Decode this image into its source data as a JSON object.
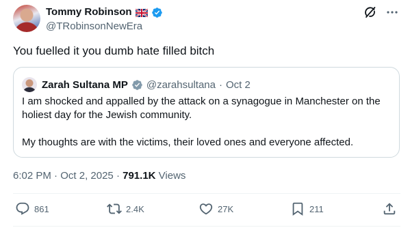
{
  "author": {
    "display_name": "Tommy Robinson",
    "handle": "@TRobinsonNewEra",
    "flag_icon": "uk-flag-icon",
    "verified_color": "#1d9bf0"
  },
  "tweet": {
    "text": "You fuelled it you dumb hate filled bitch"
  },
  "quote": {
    "display_name": "Zarah Sultana MP",
    "handle": "@zarahsultana",
    "separator": "·",
    "date": "Oct 2",
    "paragraphs": [
      "I am shocked and appalled by the attack on a synagogue in Manchester on the holiest day for the Jewish community.",
      "My thoughts are with the victims, their loved ones and everyone affected."
    ],
    "verified_color": "#829aab"
  },
  "meta": {
    "time": "6:02 PM",
    "separator": "·",
    "date": "Oct 2, 2025",
    "separator2": "·",
    "views_count": "791.1K",
    "views_label": "Views"
  },
  "actions": {
    "replies": "861",
    "reposts": "2.4K",
    "likes": "27K",
    "bookmarks": "211"
  },
  "icons": [
    "grok-icon",
    "more-icon",
    "reply-icon",
    "repost-icon",
    "like-icon",
    "bookmark-icon",
    "share-icon"
  ],
  "colors": {
    "text": "#0f1419",
    "secondary": "#536471",
    "border": "#cfd9de",
    "divider": "#eff3f4"
  }
}
